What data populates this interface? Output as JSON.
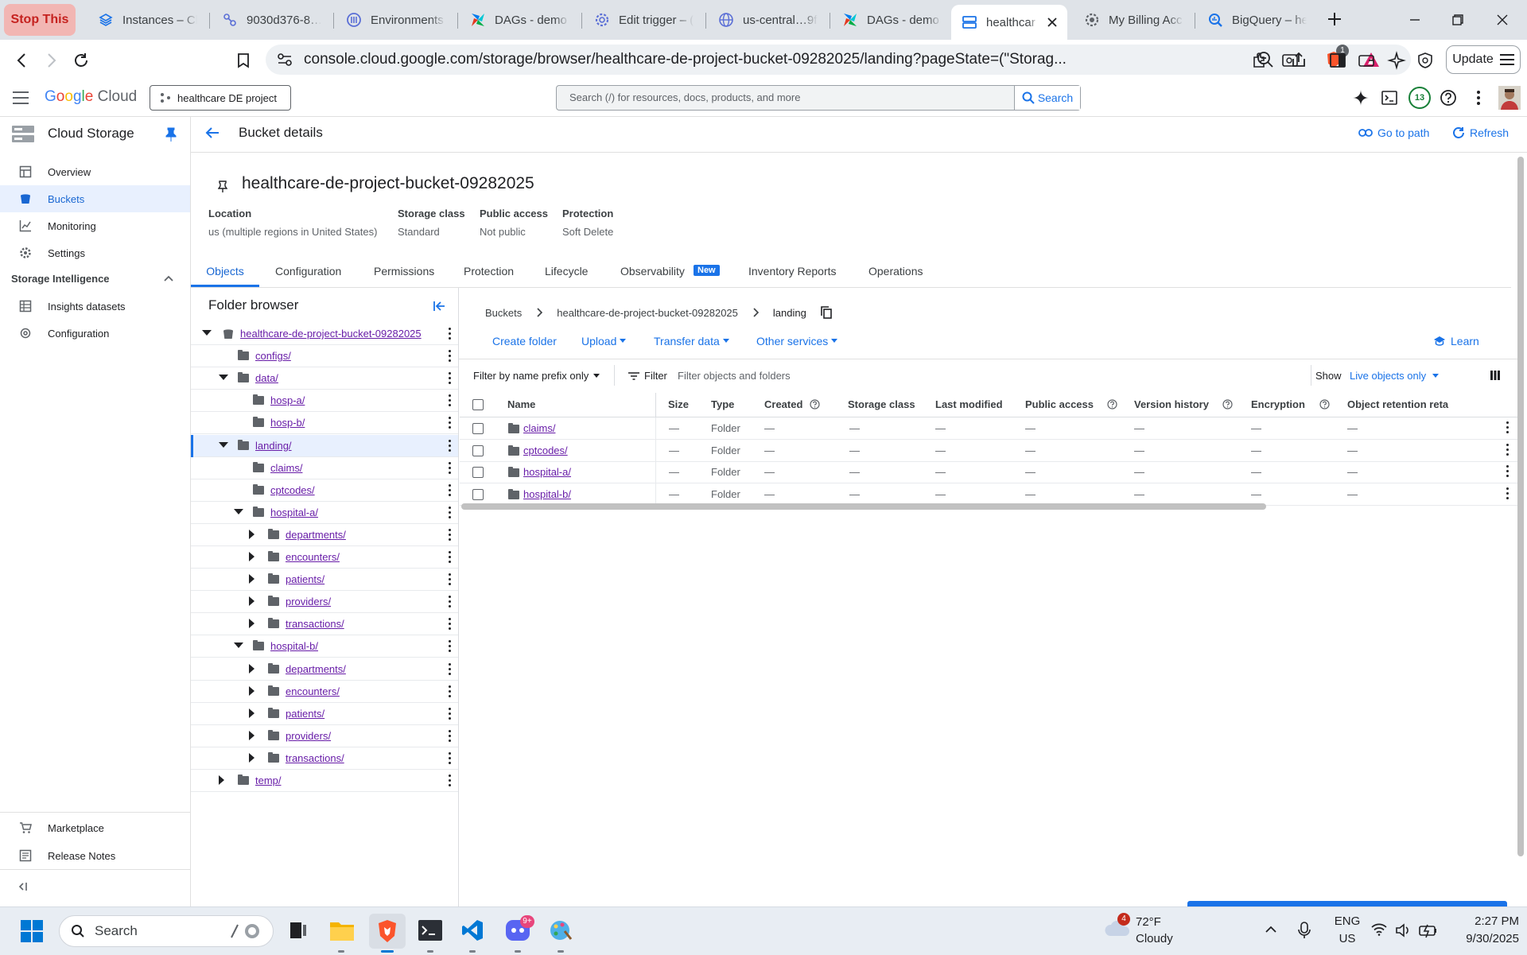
{
  "browser": {
    "stop_label": "Stop This",
    "tabs": [
      {
        "label": "Instances – Cl",
        "icon": "stack-icon"
      },
      {
        "label": "9030d376-8…",
        "icon": "tree-icon"
      },
      {
        "label": "Environments",
        "icon": "composer-icon"
      },
      {
        "label": "DAGs - demo",
        "icon": "airflow-icon"
      },
      {
        "label": "Edit trigger – (",
        "icon": "gear-icon"
      },
      {
        "label": "us-central…9f",
        "icon": "globe-icon"
      },
      {
        "label": "DAGs - demo",
        "icon": "airflow-icon"
      },
      {
        "label": "healthcar",
        "icon": "storage-icon"
      },
      {
        "label": "My Billing Acc",
        "icon": "billing-icon"
      },
      {
        "label": "BigQuery – he",
        "icon": "bigquery-icon"
      }
    ],
    "url": "console.cloud.google.com/storage/browser/healthcare-de-project-bucket-09282025/landing?pageState=(\"Storag...",
    "shield_count": "1",
    "update_label": "Update"
  },
  "gcp": {
    "logo": "Google Cloud",
    "project": "healthcare DE project",
    "search_placeholder": "Search (/) for resources, docs, products, and more",
    "search_button": "Search",
    "notif_count": "13"
  },
  "nav": {
    "product": "Cloud Storage",
    "items": [
      {
        "label": "Overview"
      },
      {
        "label": "Buckets"
      },
      {
        "label": "Monitoring"
      },
      {
        "label": "Settings"
      }
    ],
    "section": "Storage Intelligence",
    "section_items": [
      {
        "label": "Insights datasets"
      },
      {
        "label": "Configuration"
      }
    ],
    "footer": [
      {
        "label": "Marketplace"
      },
      {
        "label": "Release Notes"
      }
    ]
  },
  "page": {
    "title": "Bucket details",
    "go_to_path": "Go to path",
    "refresh": "Refresh",
    "bucket_name": "healthcare-de-project-bucket-09282025",
    "meta": [
      {
        "label": "Location",
        "value": "us (multiple regions in United States)"
      },
      {
        "label": "Storage class",
        "value": "Standard"
      },
      {
        "label": "Public access",
        "value": "Not public"
      },
      {
        "label": "Protection",
        "value": "Soft Delete"
      }
    ],
    "tabs": [
      "Objects",
      "Configuration",
      "Permissions",
      "Protection",
      "Lifecycle",
      "Observability",
      "Inventory Reports",
      "Operations"
    ],
    "new_badge": "New"
  },
  "folder_browser": {
    "title": "Folder browser",
    "tree": [
      {
        "label": "healthcare-de-project-bucket-09282025"
      },
      {
        "label": "configs/"
      },
      {
        "label": "data/"
      },
      {
        "label": "hosp-a/"
      },
      {
        "label": "hosp-b/"
      },
      {
        "label": "landing/"
      },
      {
        "label": "claims/"
      },
      {
        "label": "cptcodes/"
      },
      {
        "label": "hospital-a/"
      },
      {
        "label": "departments/"
      },
      {
        "label": "encounters/"
      },
      {
        "label": "patients/"
      },
      {
        "label": "providers/"
      },
      {
        "label": "transactions/"
      },
      {
        "label": "hospital-b/"
      },
      {
        "label": "departments/"
      },
      {
        "label": "encounters/"
      },
      {
        "label": "patients/"
      },
      {
        "label": "providers/"
      },
      {
        "label": "transactions/"
      },
      {
        "label": "temp/"
      }
    ]
  },
  "objects": {
    "breadcrumb": [
      "Buckets",
      "healthcare-de-project-bucket-09282025",
      "landing"
    ],
    "actions": [
      "Create folder",
      "Upload",
      "Transfer data",
      "Other services"
    ],
    "learn": "Learn",
    "filter_prefix": "Filter by name prefix only",
    "filter_label": "Filter",
    "filter_placeholder": "Filter objects and folders",
    "show_label": "Show",
    "show_value": "Live objects only",
    "columns": [
      "Name",
      "Size",
      "Type",
      "Created",
      "Storage class",
      "Last modified",
      "Public access",
      "Version history",
      "Encryption",
      "Object retention reta"
    ],
    "rows": [
      {
        "name": "claims/",
        "size": "—",
        "type": "Folder",
        "created": "—",
        "storage": "—",
        "modified": "—",
        "public": "—",
        "version": "—",
        "encryption": "—",
        "retention": "—"
      },
      {
        "name": "cptcodes/",
        "size": "—",
        "type": "Folder",
        "created": "—",
        "storage": "—",
        "modified": "—",
        "public": "—",
        "version": "—",
        "encryption": "—",
        "retention": "—"
      },
      {
        "name": "hospital-a/",
        "size": "—",
        "type": "Folder",
        "created": "—",
        "storage": "—",
        "modified": "—",
        "public": "—",
        "version": "—",
        "encryption": "—",
        "retention": "—"
      },
      {
        "name": "hospital-b/",
        "size": "—",
        "type": "Folder",
        "created": "—",
        "storage": "—",
        "modified": "—",
        "public": "—",
        "version": "—",
        "encryption": "—",
        "retention": "—"
      }
    ]
  },
  "taskbar": {
    "search": "Search",
    "discord_badge": "9+",
    "weather_badge": "4",
    "temp": "72°F",
    "weather": "Cloudy",
    "lang1": "ENG",
    "lang2": "US",
    "time": "2:27 PM",
    "date": "9/30/2025"
  },
  "colors": {
    "accent": "#1a73e8",
    "visited_link": "#681da8",
    "stop": "#c5221f"
  }
}
